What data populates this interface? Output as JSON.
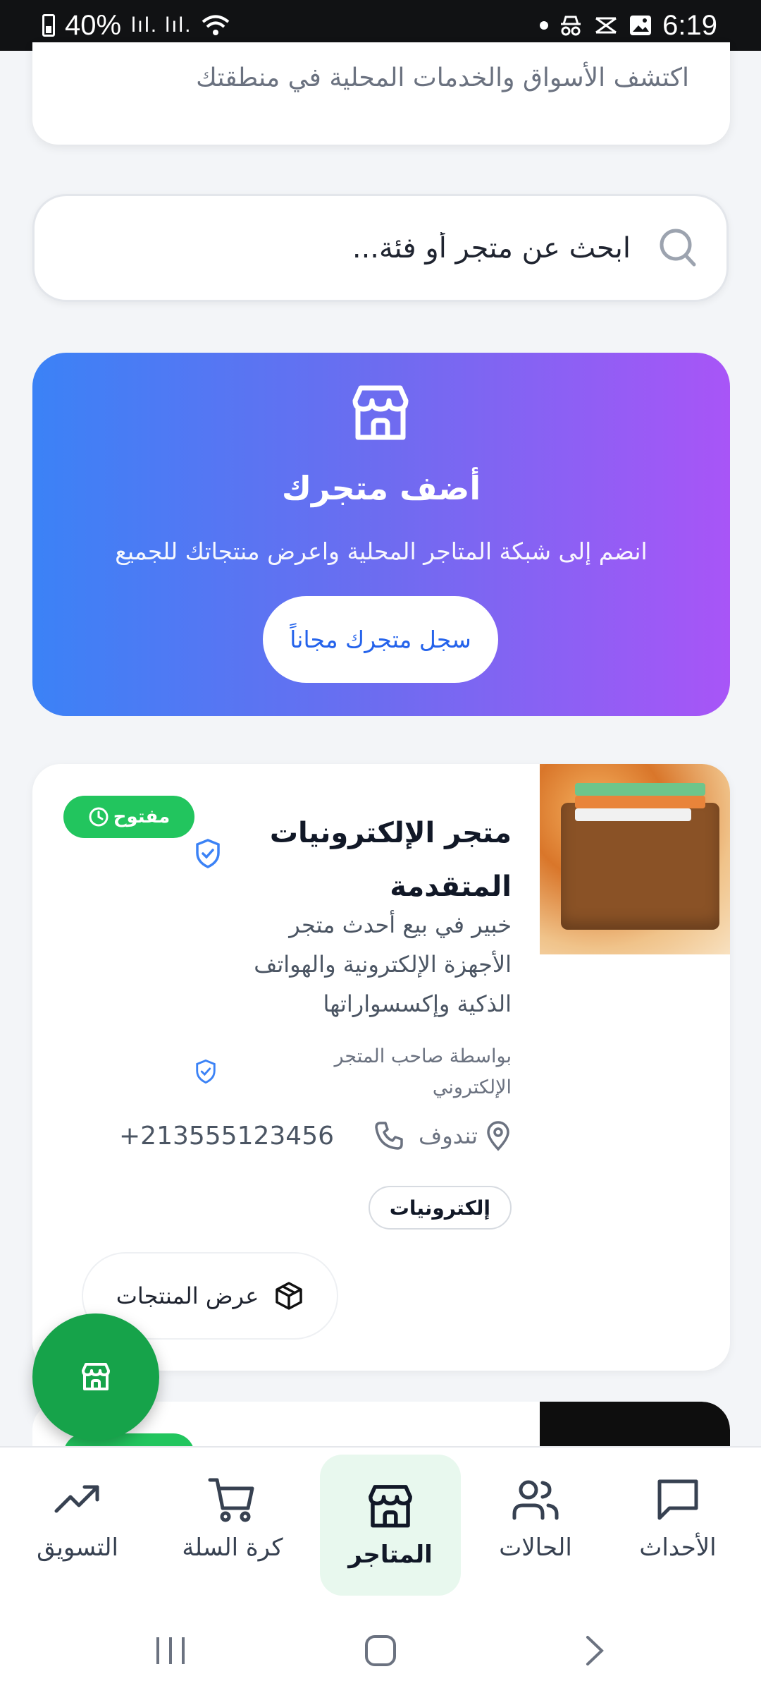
{
  "status_bar": {
    "battery": "40%",
    "signal": "lıl. lıl.",
    "time": "6:19"
  },
  "intro": {
    "subtitle": "اكتشف الأسواق والخدمات المحلية في منطقتك"
  },
  "search": {
    "placeholder": "ابحث عن متجر أو فئة...",
    "icon": "search-icon"
  },
  "promo": {
    "icon": "store-icon",
    "title": "أضف متجرك",
    "subtitle": "انضم إلى شبكة المتاجر المحلية واعرض منتجاتك للجميع",
    "button": "سجل متجرك مجاناً",
    "gradient_start": "#3b82f6",
    "gradient_end": "#a855f7"
  },
  "stores": [
    {
      "name": "متجر الإلكترونيات المتقدمة",
      "status": "مفتوح",
      "description": "خبير في بيع أحدث متجر الأجهزة الإلكترونية والهواتف الذكية وإكسسواراتها",
      "owner": "بواسطة صاحب المتجر الإلكتروني",
      "location": "تندوف",
      "phone": "+213555123456",
      "category": "إلكترونيات",
      "products_button": "عرض المنتجات",
      "badge_color": "#22c55e"
    }
  ],
  "bottom_nav": {
    "items": [
      {
        "label": "الأحداث",
        "icon": "message-icon"
      },
      {
        "label": "الحالات",
        "icon": "users-icon"
      },
      {
        "label": "المتاجر",
        "icon": "store-icon",
        "active": true
      },
      {
        "label": "كرة السلة",
        "icon": "cart-icon"
      },
      {
        "label": "التسويق",
        "icon": "trending-up-icon"
      }
    ],
    "active_bg": "#e8f8ee"
  },
  "fab": {
    "icon": "store-icon",
    "color": "#16a34a"
  }
}
